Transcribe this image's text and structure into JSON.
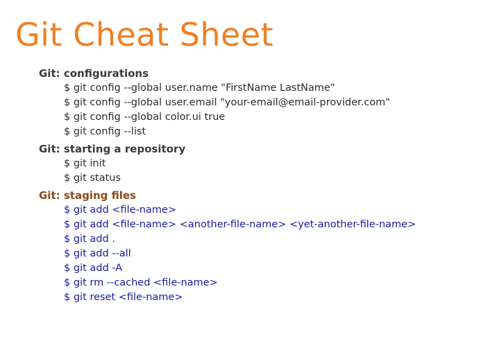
{
  "title": "Git Cheat Sheet",
  "colors": {
    "title": "#f07f24",
    "heading_default": "#3a3a3a",
    "command_default": "#2b2b2b",
    "heading_highlight": "#8a4a1c",
    "command_highlight": "#1a1aa0"
  },
  "sections": [
    {
      "heading": "Git: configurations",
      "highlight": false,
      "commands": [
        "$ git config --global user.name \"FirstName LastName\"",
        "$ git config --global user.email \"your-email@email-provider.com\"",
        "$ git config --global color.ui true",
        "$ git config --list"
      ]
    },
    {
      "heading": "Git: starting a repository",
      "highlight": false,
      "commands": [
        "$ git init",
        "$ git status"
      ]
    },
    {
      "heading": "Git: staging files",
      "highlight": true,
      "commands": [
        "$ git add <file-name>",
        "$ git add <file-name> <another-file-name> <yet-another-file-name>",
        "$ git add .",
        "$ git add --all",
        "$ git add -A",
        "$ git rm --cached <file-name>",
        "$ git reset <file-name>"
      ]
    }
  ]
}
